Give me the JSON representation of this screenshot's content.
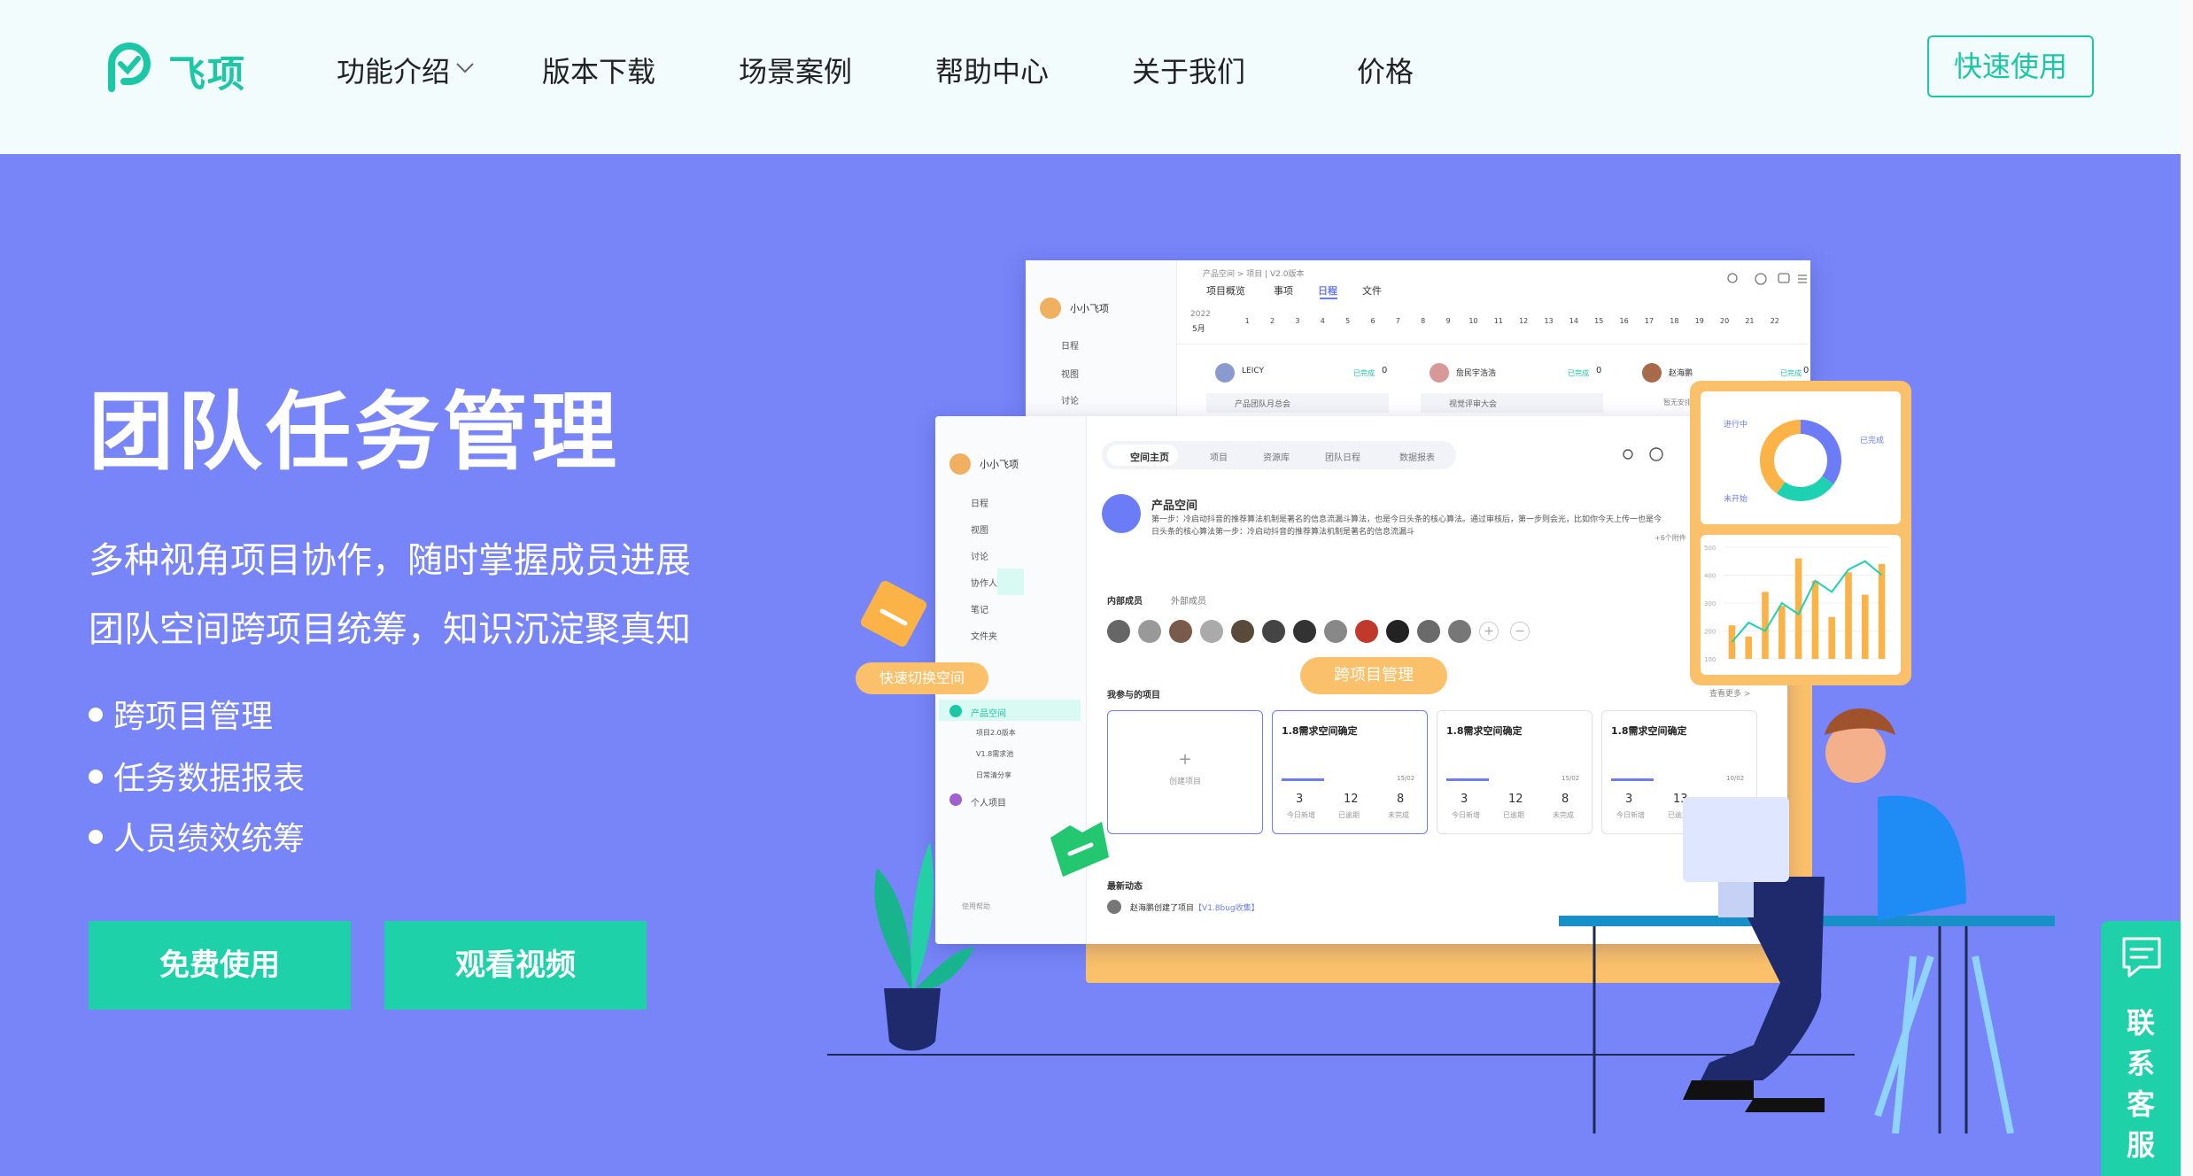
{
  "brand": {
    "name": "飞项",
    "color": "#1bc7a4"
  },
  "nav": {
    "items": [
      "功能介绍",
      "版本下载",
      "场景案例",
      "帮助中心",
      "关于我们",
      "价格"
    ],
    "cta": "快速使用"
  },
  "hero": {
    "title": "团队任务管理",
    "lines": [
      "多种视角项目协作，随时掌握成员进展",
      "团队空间跨项目统筹，知识沉淀聚真知"
    ],
    "bullets": [
      "跨项目管理",
      "任务数据报表",
      "人员绩效统筹"
    ],
    "buttons": {
      "primary": "免费使用",
      "secondary": "观看视频"
    }
  },
  "back_window": {
    "breadcrumb": "产品空间 > 项目 | V2.0版本",
    "user": "小小飞项",
    "sidebar": [
      "日程",
      "视图",
      "讨论"
    ],
    "tabs": [
      "项目概览",
      "事项",
      "日程",
      "文件"
    ],
    "active_tab": "日程",
    "year": "2022",
    "month": "5月",
    "days": [
      "1",
      "2",
      "3",
      "4",
      "5",
      "6",
      "7",
      "8",
      "9",
      "10",
      "11",
      "12",
      "13",
      "14",
      "15",
      "16",
      "17",
      "18",
      "19",
      "20",
      "21",
      "22"
    ],
    "members": [
      {
        "name": "LEICY",
        "status": "已完成",
        "count": "0",
        "task": "产品团队月总会"
      },
      {
        "name": "詹民宇浩浩",
        "status": "已完成",
        "count": "0",
        "task": "视觉评审大会"
      },
      {
        "name": "赵海鹏",
        "status": "已完成",
        "count": "0",
        "task": "暂无安排"
      }
    ]
  },
  "front_window": {
    "user": "小小飞项",
    "sidebar": [
      "日程",
      "视图",
      "讨论",
      "协作人",
      "笔记",
      "文件夹"
    ],
    "space_tree": {
      "space": "产品空间",
      "children": [
        "项目2.0版本",
        "V1.8需求池",
        "日常清分享"
      ],
      "personal": "个人项目"
    },
    "help": "使用帮助",
    "tabs": [
      "空间主页",
      "项目",
      "资源库",
      "团队日程",
      "数据报表"
    ],
    "active_tab": "空间主页",
    "space_name": "产品空间",
    "description": "第一步：冷启动抖音的推荐算法机制是著名的信息流漏斗算法，也是今日头条的核心算法。通过审核后，第一步则会光，比如你今天上传一也是今日头条的核心算法第一步：冷启动抖音的推荐算法机制是著名的信息流漏斗",
    "more": "+6个附件",
    "member_tabs": [
      "内部成员",
      "外部成员"
    ],
    "projects_label": "我参与的项目",
    "see_more": "查看更多 >",
    "create_project": "创建项目",
    "project_cards": [
      {
        "title": "1.8需求空间确定",
        "ratio": "15/02",
        "stats": [
          "3",
          "12",
          "8"
        ]
      },
      {
        "title": "1.8需求空间确定",
        "ratio": "15/02",
        "stats": [
          "3",
          "12",
          "8"
        ]
      },
      {
        "title": "1.8需求空间确定",
        "ratio": "10/02",
        "stats": [
          "3",
          "13",
          ""
        ]
      }
    ],
    "stat_labels": [
      "今日新增",
      "已逾期",
      "未完成"
    ],
    "activity_label": "最新动态",
    "activity": {
      "user": "赵海鹏",
      "text": "创建了项目",
      "link": "【V1.8bug收集】"
    }
  },
  "bubbles": {
    "switch_space": "快速切换空间",
    "cross_project": "跨项目管理"
  },
  "chart_data": [
    {
      "type": "pie",
      "labels": [
        "进行中",
        "已完成",
        "未开始"
      ],
      "values": [
        35,
        25,
        40
      ],
      "colors": [
        "#6b7cf6",
        "#1ed1b3",
        "#fbb246"
      ]
    },
    {
      "type": "bar",
      "ylim": [
        100,
        500
      ],
      "yticks": [
        "500",
        "400",
        "300",
        "200",
        "100"
      ],
      "series": [
        {
          "type": "bar",
          "color": "#fbb246",
          "values": [
            220,
            180,
            340,
            290,
            460,
            380,
            250,
            410,
            330,
            440
          ]
        },
        {
          "type": "line",
          "color": "#1ed1b3",
          "values": [
            160,
            230,
            200,
            300,
            260,
            380,
            340,
            420,
            450,
            400
          ]
        }
      ]
    }
  ],
  "contact": {
    "label": "联系客服"
  }
}
